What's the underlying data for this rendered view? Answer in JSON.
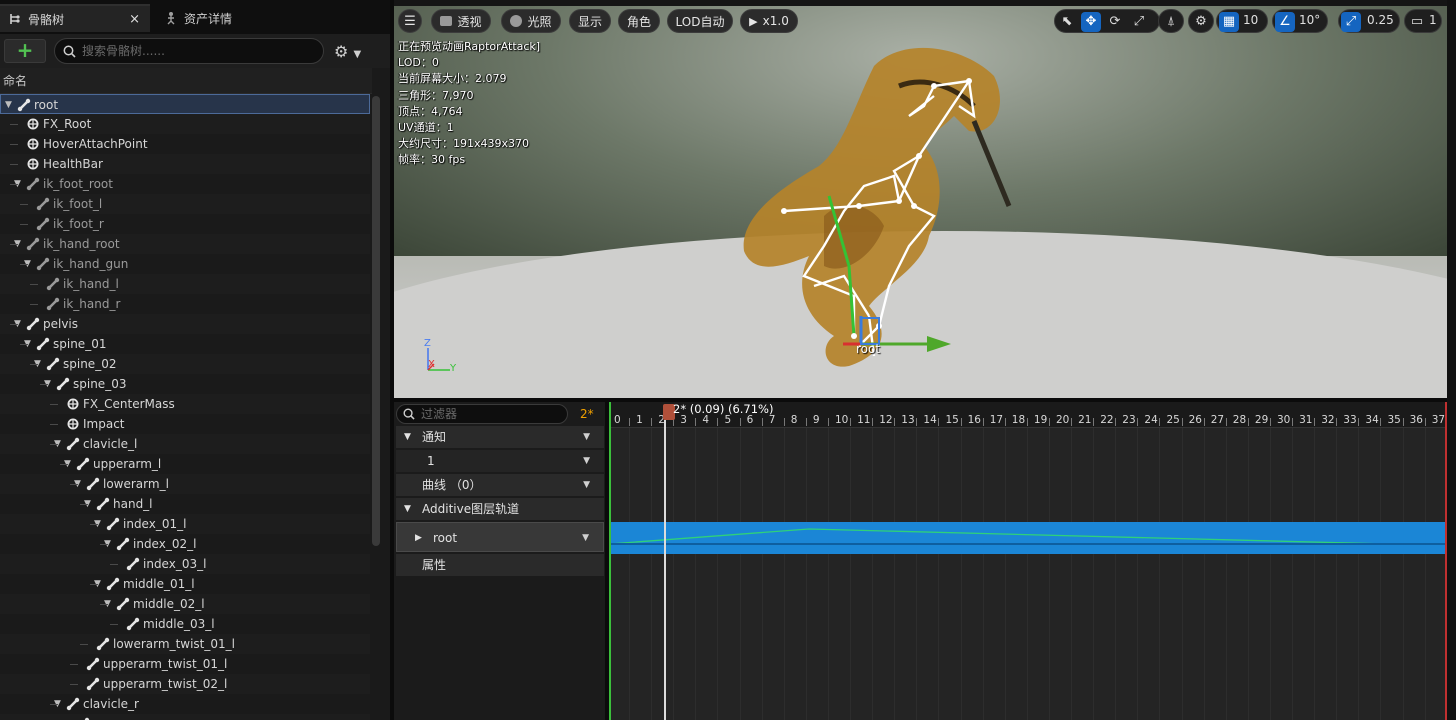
{
  "tabs": [
    {
      "label": "骨骼树",
      "icon": "skeleton-tree-icon",
      "active": true
    },
    {
      "label": "资产详情",
      "icon": "asset-details-icon",
      "active": false
    }
  ],
  "tab_close": "×",
  "toolbar": {
    "add_label": "+",
    "search_placeholder": "搜索骨骼树......",
    "settings_icon": "gear-icon"
  },
  "tree": {
    "column_header": "命名",
    "rows": [
      {
        "label": "root",
        "depth": 0,
        "type": "bone",
        "expanded": true,
        "selected": true
      },
      {
        "label": "FX_Root",
        "depth": 1,
        "type": "socket"
      },
      {
        "label": "HoverAttachPoint",
        "depth": 1,
        "type": "socket"
      },
      {
        "label": "HealthBar",
        "depth": 1,
        "type": "socket"
      },
      {
        "label": "ik_foot_root",
        "depth": 1,
        "type": "bone",
        "expanded": true,
        "dim": true
      },
      {
        "label": "ik_foot_l",
        "depth": 2,
        "type": "bone",
        "dim": true
      },
      {
        "label": "ik_foot_r",
        "depth": 2,
        "type": "bone",
        "dim": true
      },
      {
        "label": "ik_hand_root",
        "depth": 1,
        "type": "bone",
        "expanded": true,
        "dim": true
      },
      {
        "label": "ik_hand_gun",
        "depth": 2,
        "type": "bone",
        "expanded": true,
        "dim": true
      },
      {
        "label": "ik_hand_l",
        "depth": 3,
        "type": "bone",
        "dim": true
      },
      {
        "label": "ik_hand_r",
        "depth": 3,
        "type": "bone",
        "dim": true
      },
      {
        "label": "pelvis",
        "depth": 1,
        "type": "bone",
        "expanded": true
      },
      {
        "label": "spine_01",
        "depth": 2,
        "type": "bone",
        "expanded": true
      },
      {
        "label": "spine_02",
        "depth": 3,
        "type": "bone",
        "expanded": true
      },
      {
        "label": "spine_03",
        "depth": 4,
        "type": "bone",
        "expanded": true
      },
      {
        "label": "FX_CenterMass",
        "depth": 5,
        "type": "socket"
      },
      {
        "label": "Impact",
        "depth": 5,
        "type": "socket"
      },
      {
        "label": "clavicle_l",
        "depth": 5,
        "type": "bone",
        "expanded": true
      },
      {
        "label": "upperarm_l",
        "depth": 6,
        "type": "bone",
        "expanded": true
      },
      {
        "label": "lowerarm_l",
        "depth": 7,
        "type": "bone",
        "expanded": true
      },
      {
        "label": "hand_l",
        "depth": 8,
        "type": "bone",
        "expanded": true
      },
      {
        "label": "index_01_l",
        "depth": 9,
        "type": "bone",
        "expanded": true
      },
      {
        "label": "index_02_l",
        "depth": 10,
        "type": "bone",
        "expanded": true
      },
      {
        "label": "index_03_l",
        "depth": 11,
        "type": "bone"
      },
      {
        "label": "middle_01_l",
        "depth": 9,
        "type": "bone",
        "expanded": true
      },
      {
        "label": "middle_02_l",
        "depth": 10,
        "type": "bone",
        "expanded": true
      },
      {
        "label": "middle_03_l",
        "depth": 11,
        "type": "bone"
      },
      {
        "label": "lowerarm_twist_01_l",
        "depth": 8,
        "type": "bone"
      },
      {
        "label": "upperarm_twist_01_l",
        "depth": 7,
        "type": "bone"
      },
      {
        "label": "upperarm_twist_02_l",
        "depth": 7,
        "type": "bone"
      },
      {
        "label": "clavicle_r",
        "depth": 5,
        "type": "bone",
        "expanded": true
      },
      {
        "label": "",
        "depth": 6,
        "type": "bone"
      }
    ]
  },
  "viewport": {
    "buttons": [
      "透视",
      "光照",
      "显示",
      "角色",
      "LOD自动",
      "x1.0"
    ],
    "menu_icon": "hamburger-menu-icon",
    "stats": [
      "正在预览动画RaptorAttack]",
      "LOD：0",
      "当前屏幕大小：2.079",
      "三角形：7,970",
      "顶点：4,764",
      "UV通道：1",
      "大约尺寸：191x439x370",
      "帧率：30 fps"
    ],
    "grid_snap": "10",
    "rot_snap": "10°",
    "scale_snap": "0.25",
    "camera_speed": "1",
    "bone_label": "root",
    "axis_labels": {
      "z": "Z",
      "x": "X",
      "y": "Y"
    }
  },
  "anim": {
    "filter_placeholder": "过滤器",
    "current_frame": "2*",
    "playhead_label": "2* (0.09) (6.71%)",
    "tracks": [
      {
        "label": "通知",
        "type": "section"
      },
      {
        "label": "1",
        "type": "item"
      },
      {
        "label": "曲线 （0）",
        "type": "section"
      },
      {
        "label": "Additive图层轨道",
        "type": "section"
      },
      {
        "label": "root",
        "type": "item"
      },
      {
        "label": "属性",
        "type": "section"
      }
    ],
    "ruler_ticks": [
      "0",
      "1",
      "2",
      "3",
      "4",
      "5",
      "6",
      "7",
      "8",
      "9",
      "10",
      "11",
      "12",
      "13",
      "14",
      "15",
      "16",
      "17",
      "18",
      "19",
      "20",
      "21",
      "22",
      "23",
      "24",
      "25",
      "26",
      "27",
      "28",
      "29",
      "30",
      "31",
      "32",
      "33",
      "34",
      "35",
      "36",
      "37"
    ]
  },
  "colors": {
    "accent_blue": "#1565c0",
    "track_blue": "#1b86d6",
    "add_green": "#52c152",
    "frame_orange": "#f0a000",
    "playhead": "#b0503a"
  }
}
